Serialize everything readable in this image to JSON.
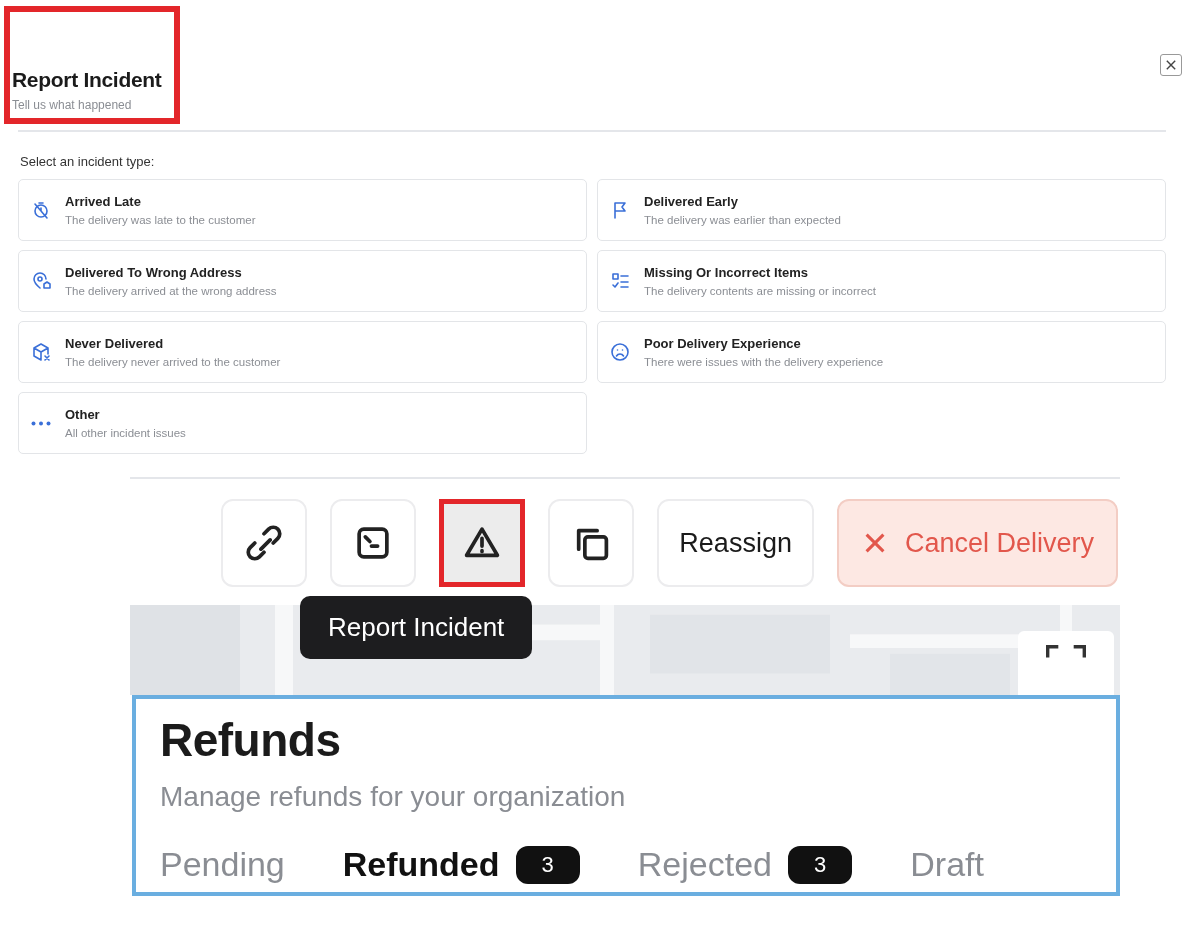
{
  "dialog": {
    "title": "Report Incident",
    "subtitle": "Tell us what happened",
    "header_outlined": true,
    "prompt": "Select an incident type:",
    "incident_types": [
      {
        "kind": "late",
        "title": "Arrived Late",
        "description": "The delivery was late to the customer"
      },
      {
        "kind": "early",
        "title": "Delivered Early",
        "description": "The delivery was earlier than expected"
      },
      {
        "kind": "wrong_address",
        "title": "Delivered To Wrong Address",
        "description": "The delivery arrived at the wrong address"
      },
      {
        "kind": "missing_items",
        "title": "Missing Or Incorrect Items",
        "description": "The delivery contents are missing or incorrect"
      },
      {
        "kind": "never_delivered",
        "title": "Never Delivered",
        "description": "The delivery never arrived to the customer"
      },
      {
        "kind": "poor_experience",
        "title": "Poor Delivery Experience",
        "description": "There were issues with the delivery experience"
      },
      {
        "kind": "other",
        "title": "Other",
        "description": "All other incident issues"
      }
    ]
  },
  "toolbar": {
    "buttons": [
      {
        "kind": "link",
        "active": false,
        "outlined": false
      },
      {
        "kind": "terminal",
        "active": false,
        "outlined": false
      },
      {
        "kind": "warning",
        "active": true,
        "outlined": true
      },
      {
        "kind": "copy",
        "active": false,
        "outlined": false
      },
      {
        "kind": "text",
        "label": "Reassign",
        "active": false,
        "outlined": false
      },
      {
        "kind": "danger",
        "label": "Cancel Delivery",
        "active": false,
        "outlined": false
      }
    ],
    "tooltip": "Report Incident"
  },
  "refunds": {
    "title": "Refunds",
    "subtitle": "Manage refunds for your organization",
    "outlined": true,
    "tabs": [
      {
        "label": "Pending",
        "selected": false
      },
      {
        "label": "Refunded",
        "count": "3",
        "selected": true
      },
      {
        "label": "Rejected",
        "count": "3",
        "selected": false
      },
      {
        "label": "Draft",
        "selected": false
      }
    ]
  }
}
